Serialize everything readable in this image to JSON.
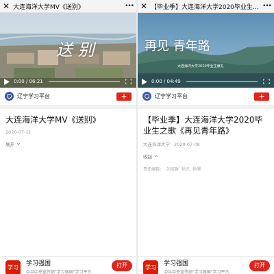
{
  "left": {
    "window_title": "大连海洋大学MV《送别》",
    "video": {
      "elapsed": "0:00",
      "duration": "06:21",
      "overlay_text": "送 别"
    },
    "source": {
      "name": "辽宁学习平台",
      "follow_symbol": "+"
    },
    "article": {
      "title": "大连海洋大学MV《送别》",
      "date": "2020-07-11",
      "toggle_label": "展开"
    }
  },
  "right": {
    "window_title": "【毕业季】大连海洋大学2020毕业生之...",
    "video": {
      "elapsed": "0:00",
      "duration": "04:49",
      "overlay_text": "再见 青年路",
      "overlay_sub": "大连海洋大学2020毕业生献礼"
    },
    "source": {
      "name": "辽宁学习平台",
      "follow_symbol": "+"
    },
    "article": {
      "title": "【毕业季】大连海洋大学2020毕业生之歌《再见青年路》",
      "author": "大连海洋大学",
      "date": "2020-07-08",
      "toggle_label": "收起",
      "editor_label": "责任编辑：",
      "editors": [
        "刘冠群",
        "杨光",
        "杨珊"
      ]
    }
  },
  "footer": {
    "app_name": "学习强国",
    "app_desc": "中共中央宣传部\"学习强国\"学习平台",
    "open_label": "打开",
    "logo_char": "学习"
  },
  "colors": {
    "brand_red": "#e2231a",
    "source_blue": "#2b5fb3"
  }
}
